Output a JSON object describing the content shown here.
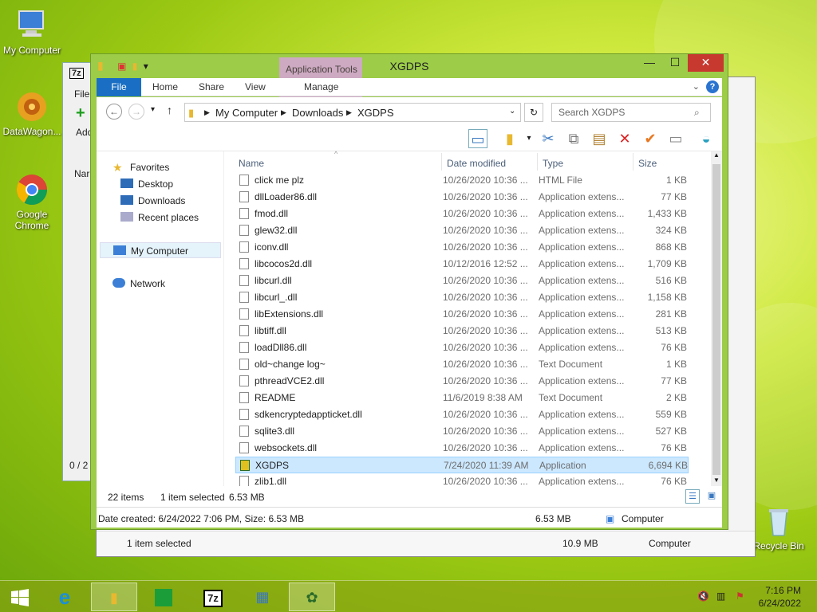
{
  "desktop": {
    "icons": [
      {
        "label": "My Computer"
      },
      {
        "label": "DataWagon..."
      },
      {
        "label": "Google Chrome"
      },
      {
        "label": "Recycle Bin"
      }
    ]
  },
  "background_window": {
    "app_icon": "7z",
    "file_menu": "File",
    "add_label": "Add",
    "name_header": "Nar",
    "status": "0 / 2",
    "status_selected": "1 item selected",
    "status_size": "10.9 MB",
    "status_location": "Computer"
  },
  "window": {
    "title": "XGDPS",
    "contextual_tab_group": "Application Tools",
    "ribbon_tabs": [
      "File",
      "Home",
      "Share",
      "View",
      "Manage"
    ],
    "address": {
      "root": "My Computer",
      "crumb1": "Downloads",
      "crumb2": "XGDPS"
    },
    "search_placeholder": "Search XGDPS",
    "controls": {
      "minimize": "—",
      "maximize": "☐",
      "close": "✕"
    }
  },
  "navpane": {
    "favorites": "Favorites",
    "desktop": "Desktop",
    "downloads": "Downloads",
    "recent": "Recent places",
    "mycomputer": "My Computer",
    "network": "Network"
  },
  "columns": {
    "name": "Name",
    "date": "Date modified",
    "type": "Type",
    "size": "Size"
  },
  "files": [
    {
      "name": "click me plz",
      "date": "10/26/2020 10:36 ...",
      "type": "HTML File",
      "size": "1 KB"
    },
    {
      "name": "dllLoader86.dll",
      "date": "10/26/2020 10:36 ...",
      "type": "Application extens...",
      "size": "77 KB"
    },
    {
      "name": "fmod.dll",
      "date": "10/26/2020 10:36 ...",
      "type": "Application extens...",
      "size": "1,433 KB"
    },
    {
      "name": "glew32.dll",
      "date": "10/26/2020 10:36 ...",
      "type": "Application extens...",
      "size": "324 KB"
    },
    {
      "name": "iconv.dll",
      "date": "10/26/2020 10:36 ...",
      "type": "Application extens...",
      "size": "868 KB"
    },
    {
      "name": "libcocos2d.dll",
      "date": "10/12/2016 12:52 ...",
      "type": "Application extens...",
      "size": "1,709 KB"
    },
    {
      "name": "libcurl.dll",
      "date": "10/26/2020 10:36 ...",
      "type": "Application extens...",
      "size": "516 KB"
    },
    {
      "name": "libcurl_.dll",
      "date": "10/26/2020 10:36 ...",
      "type": "Application extens...",
      "size": "1,158 KB"
    },
    {
      "name": "libExtensions.dll",
      "date": "10/26/2020 10:36 ...",
      "type": "Application extens...",
      "size": "281 KB"
    },
    {
      "name": "libtiff.dll",
      "date": "10/26/2020 10:36 ...",
      "type": "Application extens...",
      "size": "513 KB"
    },
    {
      "name": "loadDll86.dll",
      "date": "10/26/2020 10:36 ...",
      "type": "Application extens...",
      "size": "76 KB"
    },
    {
      "name": "old~change log~",
      "date": "10/26/2020 10:36 ...",
      "type": "Text Document",
      "size": "1 KB"
    },
    {
      "name": "pthreadVCE2.dll",
      "date": "10/26/2020 10:36 ...",
      "type": "Application extens...",
      "size": "77 KB"
    },
    {
      "name": "README",
      "date": "11/6/2019 8:38 AM",
      "type": "Text Document",
      "size": "2 KB"
    },
    {
      "name": "sdkencryptedappticket.dll",
      "date": "10/26/2020 10:36 ...",
      "type": "Application extens...",
      "size": "559 KB"
    },
    {
      "name": "sqlite3.dll",
      "date": "10/26/2020 10:36 ...",
      "type": "Application extens...",
      "size": "527 KB"
    },
    {
      "name": "websockets.dll",
      "date": "10/26/2020 10:36 ...",
      "type": "Application extens...",
      "size": "76 KB"
    },
    {
      "name": "XGDPS",
      "date": "7/24/2020 11:39 AM",
      "type": "Application",
      "size": "6,694 KB",
      "selected": true
    },
    {
      "name": "zlib1.dll",
      "date": "10/26/2020 10:36 ...",
      "type": "Application extens...",
      "size": "76 KB"
    }
  ],
  "status": {
    "items": "22 items",
    "selected": "1 item selected",
    "size": "6.53 MB"
  },
  "details": {
    "info": "Date created: 6/24/2022 7:06 PM, Size: 6.53 MB",
    "size": "6.53 MB",
    "location": "Computer"
  },
  "taskbar": {
    "time": "7:16 PM",
    "date": "6/24/2022",
    "seven_zip": "7z"
  }
}
